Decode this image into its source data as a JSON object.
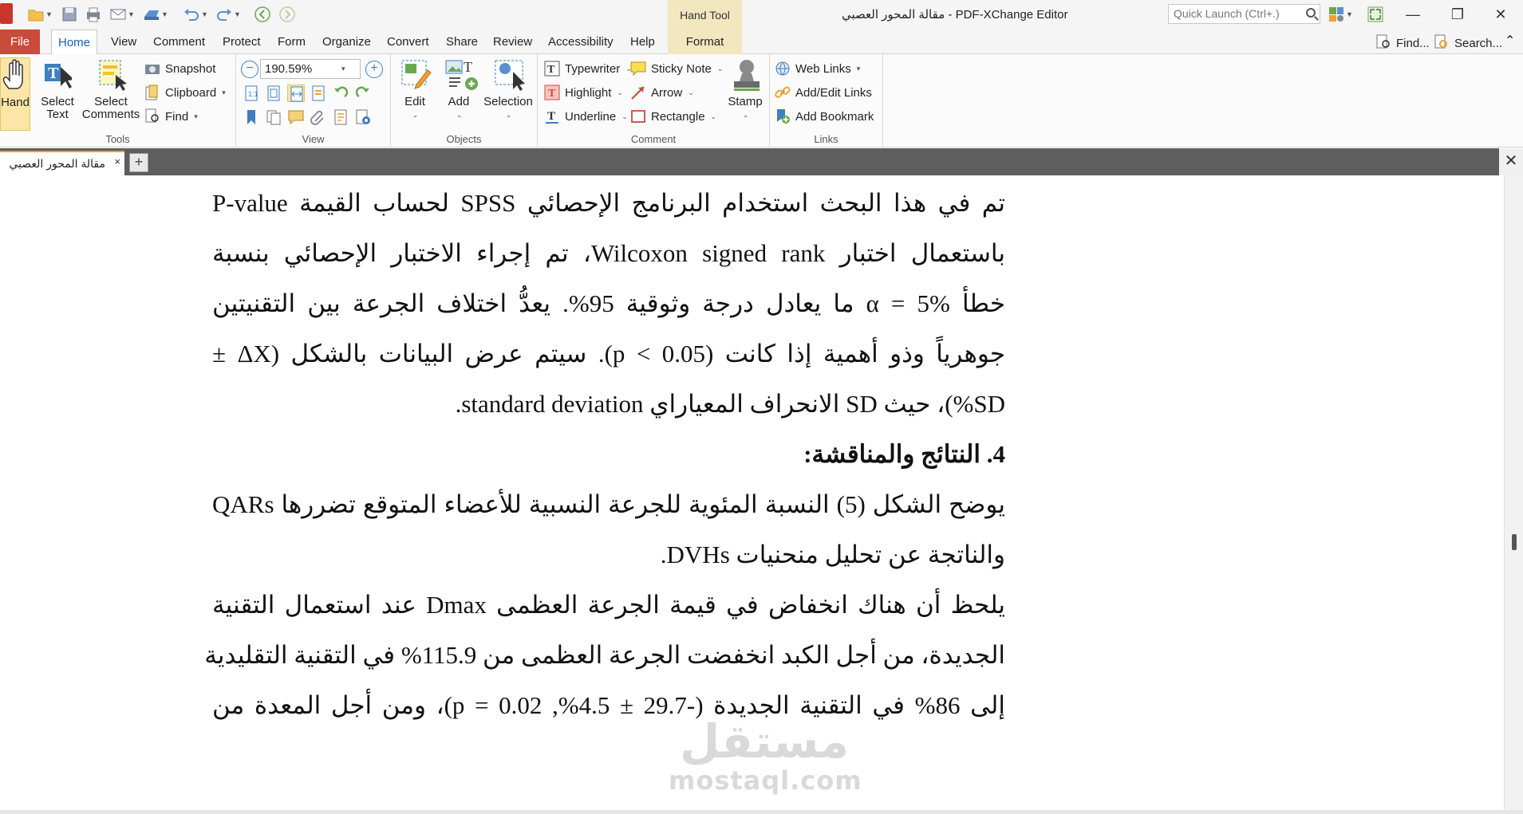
{
  "window": {
    "title": "مقالة المحور العصبي - PDF-XChange Editor",
    "context_tool": "Hand Tool",
    "quick_launch_placeholder": "Quick Launch (Ctrl+.)",
    "minimize": "—",
    "restore": "❐",
    "close": "✕"
  },
  "menu": {
    "file": "File",
    "tabs": [
      "Home",
      "View",
      "Comment",
      "Protect",
      "Form",
      "Organize",
      "Convert",
      "Share",
      "Review",
      "Accessibility",
      "Help"
    ],
    "format": "Format",
    "find": "Find...",
    "search": "Search...",
    "collapse": "⌃"
  },
  "ribbon": {
    "tools": {
      "label": "Tools",
      "hand": "Hand",
      "select_text_1": "Select",
      "select_text_2": "Text",
      "select_comments_1": "Select",
      "select_comments_2": "Comments",
      "snapshot": "Snapshot",
      "clipboard": "Clipboard",
      "find": "Find"
    },
    "view": {
      "label": "View",
      "zoom": "190.59%"
    },
    "objects": {
      "label": "Objects",
      "edit": "Edit",
      "add": "Add",
      "selection": "Selection"
    },
    "comment": {
      "label": "Comment",
      "typewriter": "Typewriter",
      "sticky_note": "Sticky Note",
      "highlight": "Highlight",
      "arrow": "Arrow",
      "underline": "Underline",
      "rectangle": "Rectangle",
      "stamp": "Stamp"
    },
    "links": {
      "label": "Links",
      "web_links": "Web Links",
      "add_edit_links": "Add/Edit Links",
      "add_bookmark": "Add Bookmark"
    }
  },
  "doc_tab": {
    "title": "مقالة المحور العصبي",
    "close": "×",
    "new": "+",
    "close_all": "✕"
  },
  "document": {
    "lines": [
      "تم في هذا البحث استخدام البرنامج الإحصائي SPSS لحساب القيمة P-value",
      "باستعمال اختبار Wilcoxon signed rank، تم إجراء الاختبار الإحصائي بنسبة",
      "خطأ α = 5% ما يعادل درجة وثوقية 95%. يعدُّ اختلاف الجرعة بين التقنيتين",
      "جوهرياً وذو أهمية إذا كانت (p < 0.05). سيتم عرض البيانات بالشكل (ΔX ±",
      "SD%)، حيث SD الانحراف المعياراي standard deviation.",
      "4. النتائج والمناقشة:",
      "يوضح الشكل (5) النسبة المئوية للجرعة النسبية للأعضاء المتوقع تضررها QARs",
      "والناتجة عن تحليل منحنيات DVHs.",
      "يلحظ أن هناك انخفاض في قيمة الجرعة العظمى Dmax عند استعمال التقنية",
      "الجديدة، من أجل الكبد انخفضت الجرعة العظمى من 115.9% في التقنية التقليدية",
      "إلى 86% في التقنية الجديدة (-29.7 ± 4.5%, p = 0.02)، ومن أجل المعدة من"
    ]
  },
  "watermark": {
    "arabic": "مستقل",
    "latin": "mostaql.com"
  }
}
